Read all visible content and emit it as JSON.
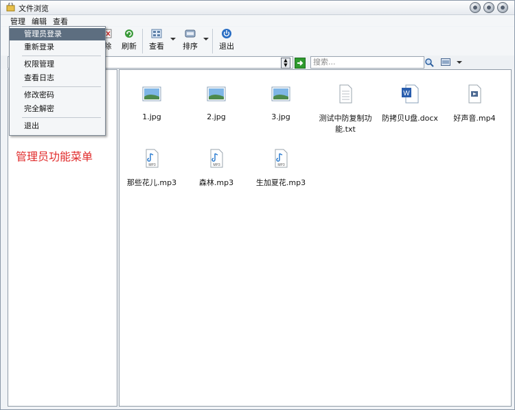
{
  "window": {
    "title": "文件浏览"
  },
  "menubar": {
    "items": [
      "管理",
      "编辑",
      "查看"
    ]
  },
  "dropdown": {
    "items": [
      "管理员登录",
      "重新登录",
      "权限管理",
      "查看日志",
      "修改密码",
      "完全解密",
      "退出"
    ],
    "active_index": 0
  },
  "toolbar": {
    "delete_label": "除",
    "refresh_label": "刷新",
    "view_label": "查看",
    "sort_label": "排序",
    "exit_label": "退出"
  },
  "search": {
    "placeholder": "搜索..."
  },
  "annotation": "管理员功能菜单",
  "files": [
    {
      "name": "1.jpg",
      "type": "image"
    },
    {
      "name": "2.jpg",
      "type": "image"
    },
    {
      "name": "3.jpg",
      "type": "image"
    },
    {
      "name": "测试中防复制功能.txt",
      "type": "text"
    },
    {
      "name": "防拷贝U盘.docx",
      "type": "word"
    },
    {
      "name": "好声音.mp4",
      "type": "video"
    },
    {
      "name": "那些花儿.mp3",
      "type": "audio"
    },
    {
      "name": "森林.mp3",
      "type": "audio"
    },
    {
      "name": "生加夏花.mp3",
      "type": "audio"
    }
  ],
  "colors": {
    "annotation": "#e02a2a",
    "menu_highlight": "#5d6e80"
  }
}
